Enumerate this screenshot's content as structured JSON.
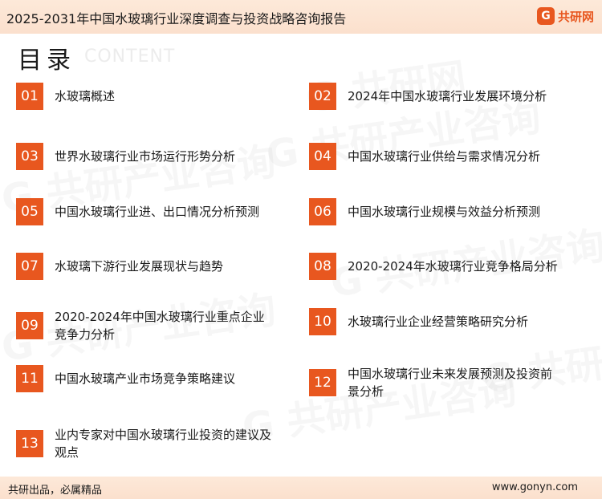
{
  "header": {
    "title": "2025-2031年中国水玻璃行业深度调查与投资战略咨询报告",
    "brand": {
      "mark": "G",
      "name": "共研网"
    }
  },
  "toc": {
    "title": "目录",
    "subtitle": "CONTENT",
    "items": [
      {
        "num": "01",
        "label": "水玻璃概述"
      },
      {
        "num": "02",
        "label": "2024年中国水玻璃行业发展环境分析"
      },
      {
        "num": "03",
        "label": "世界水玻璃行业市场运行形势分析"
      },
      {
        "num": "04",
        "label": "中国水玻璃行业供给与需求情况分析"
      },
      {
        "num": "05",
        "label": "中国水玻璃行业进、出口情况分析预测"
      },
      {
        "num": "06",
        "label": "中国水玻璃行业规模与效益分析预测"
      },
      {
        "num": "07",
        "label": "水玻璃下游行业发展现状与趋势"
      },
      {
        "num": "08",
        "label": "2020-2024年水玻璃行业竞争格局分析"
      },
      {
        "num": "09",
        "label": "2020-2024年中国水玻璃行业重点企业竞争力分析"
      },
      {
        "num": "10",
        "label": "水玻璃行业企业经营策略研究分析"
      },
      {
        "num": "11",
        "label": "中国水玻璃产业市场竞争策略建议"
      },
      {
        "num": "12",
        "label": "中国水玻璃行业未来发展预测及投资前景分析"
      },
      {
        "num": "13",
        "label": "业内专家对中国水玻璃行业投资的建议及观点"
      }
    ]
  },
  "footer": {
    "slogan": "共研出品，必属精品",
    "url": "www.gonyn.com"
  },
  "colors": {
    "accent": "#e8571f",
    "header_bg": "#fbe0cd"
  }
}
